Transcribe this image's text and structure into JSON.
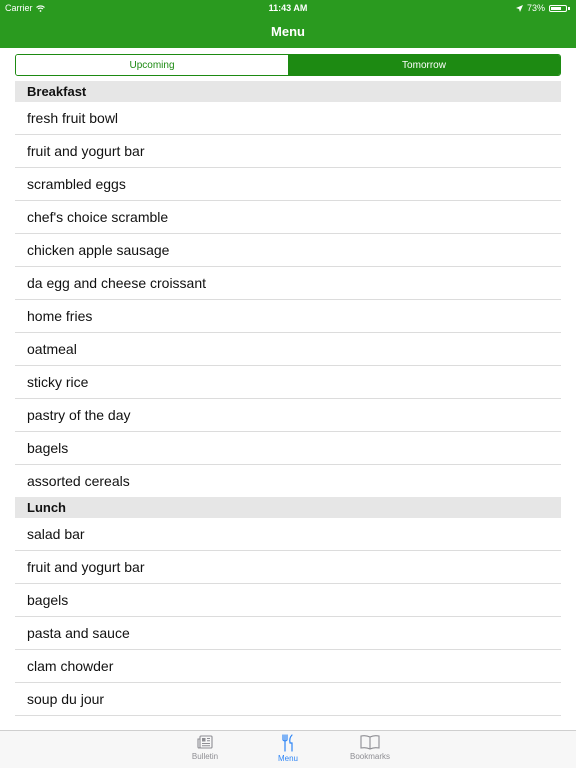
{
  "status_bar": {
    "carrier": "Carrier",
    "time": "11:43 AM",
    "battery": "73%",
    "battery_level": 0.73
  },
  "nav": {
    "title": "Menu"
  },
  "segments": {
    "upcoming": "Upcoming",
    "tomorrow": "Tomorrow",
    "selected": "Tomorrow"
  },
  "sections": [
    {
      "title": "Breakfast",
      "items": [
        "fresh fruit bowl",
        "fruit and yogurt bar",
        "scrambled eggs",
        "chef's choice scramble",
        "chicken apple sausage",
        "da egg and cheese croissant",
        "home fries",
        "oatmeal",
        "sticky rice",
        "pastry of the day",
        "bagels",
        "assorted cereals"
      ]
    },
    {
      "title": "Lunch",
      "items": [
        "salad bar",
        "fruit and yogurt bar",
        "bagels",
        "pasta and sauce",
        "clam chowder",
        "soup du jour"
      ]
    }
  ],
  "tabbar": {
    "tabs": [
      {
        "label": "Bulletin",
        "icon": "newspaper-icon"
      },
      {
        "label": "Menu",
        "icon": "fork-knife-icon",
        "active": true
      },
      {
        "label": "Bookmarks",
        "icon": "book-icon"
      }
    ]
  }
}
